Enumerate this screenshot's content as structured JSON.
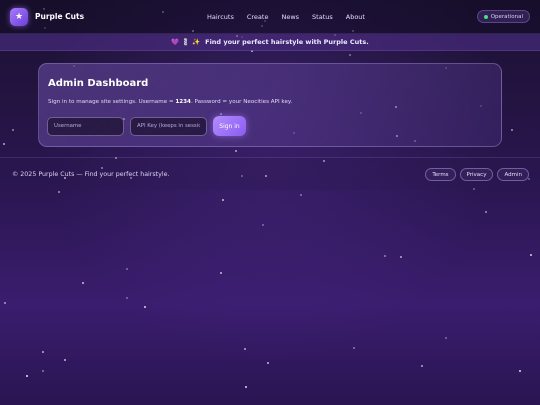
{
  "header": {
    "logo_glyph": "★",
    "brand": "Purple Cuts",
    "nav": [
      "Haircuts",
      "Create",
      "News",
      "Status",
      "About"
    ],
    "status": "Operational",
    "status_color": "#4ade80"
  },
  "banner": {
    "emojis": "💜 💈 ✨",
    "text": "Find your perfect hairstyle with Purple Cuts."
  },
  "admin": {
    "title": "Admin Dashboard",
    "desc_prefix": "Sign in to manage site settings. Username = ",
    "username_hint": "1234",
    "desc_suffix": ". Password = your Neocities API key.",
    "username_placeholder": "Username",
    "apikey_placeholder": "API Key (keeps in session)",
    "signin_label": "Sign in"
  },
  "footer": {
    "text": "© 2025 Purple Cuts — Find your perfect hairstyle.",
    "links": [
      "Terms",
      "Privacy",
      "Admin"
    ]
  },
  "colors": {
    "accent": "#a77bff",
    "background": "#2a1650"
  }
}
